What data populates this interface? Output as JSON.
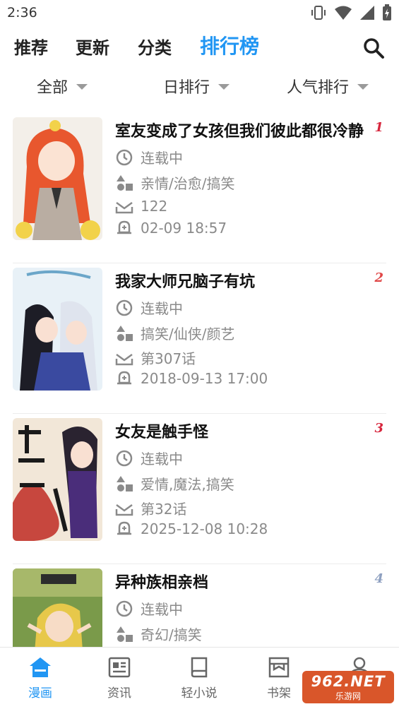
{
  "status_bar": {
    "time": "2:36"
  },
  "top_tabs": [
    {
      "label": "推荐"
    },
    {
      "label": "更新"
    },
    {
      "label": "分类"
    },
    {
      "label": "排行榜",
      "active": true
    }
  ],
  "filters": [
    {
      "label": "全部"
    },
    {
      "label": "日排行"
    },
    {
      "label": "人气排行"
    }
  ],
  "comics": [
    {
      "title": "室友变成了女孩但我们彼此都很冷静",
      "rank": "1",
      "status": "连载中",
      "tags": "亲情/治愈/搞笑",
      "chapter": "122",
      "updated": "02-09 18:57"
    },
    {
      "title": "我家大师兄脑子有坑",
      "rank": "2",
      "status": "连载中",
      "tags": "搞笑/仙侠/颜艺",
      "chapter": "第307话",
      "updated": "2018-09-13 17:00"
    },
    {
      "title": "女友是触手怪",
      "rank": "3",
      "status": "连载中",
      "tags": "爱情,魔法,搞笑",
      "chapter": "第32话",
      "updated": "2025-12-08 10:28"
    },
    {
      "title": "异种族相亲档",
      "rank": "4",
      "status": "连载中",
      "tags": "奇幻/搞笑",
      "chapter": "",
      "updated": ""
    }
  ],
  "bottom_nav": [
    {
      "label": "漫画",
      "icon": "home-icon",
      "active": true
    },
    {
      "label": "资讯",
      "icon": "news-icon"
    },
    {
      "label": "轻小说",
      "icon": "book-icon"
    },
    {
      "label": "书架",
      "icon": "shelf-icon"
    },
    {
      "label": "",
      "icon": "profile-icon"
    }
  ],
  "watermark": {
    "main": "962.NET",
    "sub": "乐游网"
  },
  "colors": {
    "accent": "#2196f3",
    "meta_text": "#8a8a8a",
    "watermark": "#d9562a"
  }
}
